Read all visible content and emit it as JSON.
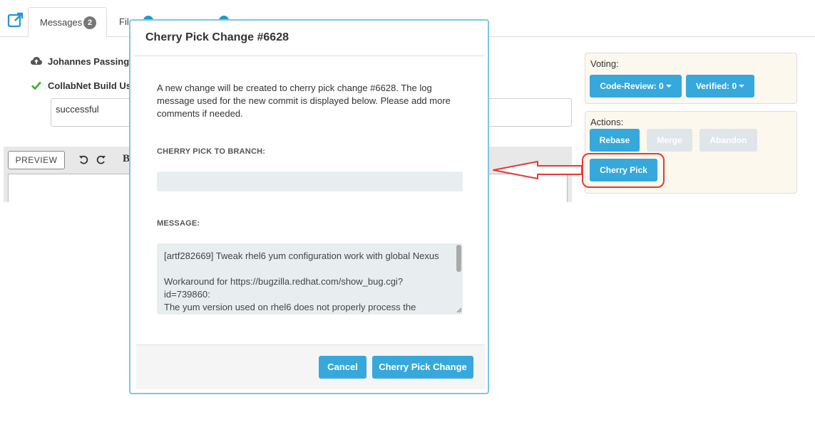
{
  "tabs": {
    "messages_label": "Messages",
    "messages_count": "2",
    "files_label": "File"
  },
  "messages": {
    "row1_author": "Johannes Passing",
    "row2_author": "CollabNet Build Use",
    "row2_text": "successful"
  },
  "editor": {
    "preview_label": "PREVIEW",
    "bold_glyph": "B"
  },
  "voting": {
    "title": "Voting:",
    "code_review_label": "Code-Review: 0",
    "verified_label": "Verified: 0"
  },
  "actions": {
    "title": "Actions:",
    "rebase_label": "Rebase",
    "merge_label": "Merge",
    "abandon_label": "Abandon",
    "cherry_pick_label": "Cherry Pick"
  },
  "modal": {
    "title": "Cherry Pick Change #6628",
    "description": "A new change will be created to cherry pick change #6628. The log message used for the new commit is displayed below. Please add more comments if needed.",
    "branch_label": "CHERRY PICK TO BRANCH:",
    "branch_value": "",
    "message_label": "MESSAGE:",
    "message_lines": [
      "[artf282669] Tweak rhel6 yum configuration work with global Nexus",
      "",
      "Workaround for https://bugzilla.redhat.com/show_bug.cgi?",
      "id=739860:",
      "The yum version used on rhel6 does not properly process the"
    ],
    "cancel_label": "Cancel",
    "confirm_label": "Cherry Pick Change"
  },
  "colors": {
    "primary": "#36a8dc",
    "disabled": "#dfe6e9",
    "highlight": "#e53935",
    "panel_bg": "#fdf8ee"
  }
}
